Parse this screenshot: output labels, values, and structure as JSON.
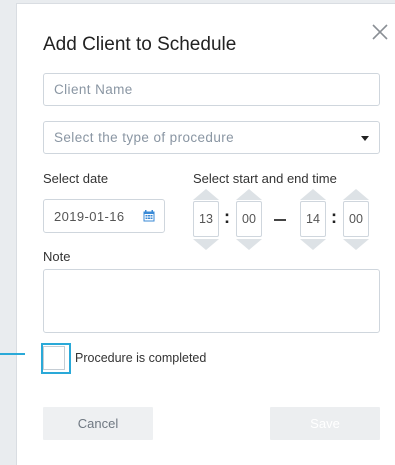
{
  "dialog": {
    "title": "Add Client to Schedule",
    "client_name": {
      "placeholder": "Client Name",
      "value": ""
    },
    "procedure": {
      "placeholder": "Select the type of procedure"
    },
    "date": {
      "label": "Select date",
      "value": "2019-01-16"
    },
    "time": {
      "label": "Select start and end time",
      "start_hour": "13",
      "start_minute": "00",
      "end_hour": "14",
      "end_minute": "00",
      "separator": ":"
    },
    "note": {
      "label": "Note",
      "value": ""
    },
    "completed": {
      "label": "Procedure is completed",
      "checked": false
    },
    "buttons": {
      "cancel": "Cancel",
      "save": "Save"
    }
  },
  "colors": {
    "accent": "#2aa9d8",
    "calendar_icon": "#3a8ad6"
  },
  "icons": {
    "close": "close-icon",
    "calendar": "calendar-icon",
    "dropdown": "chevron-down-icon"
  }
}
